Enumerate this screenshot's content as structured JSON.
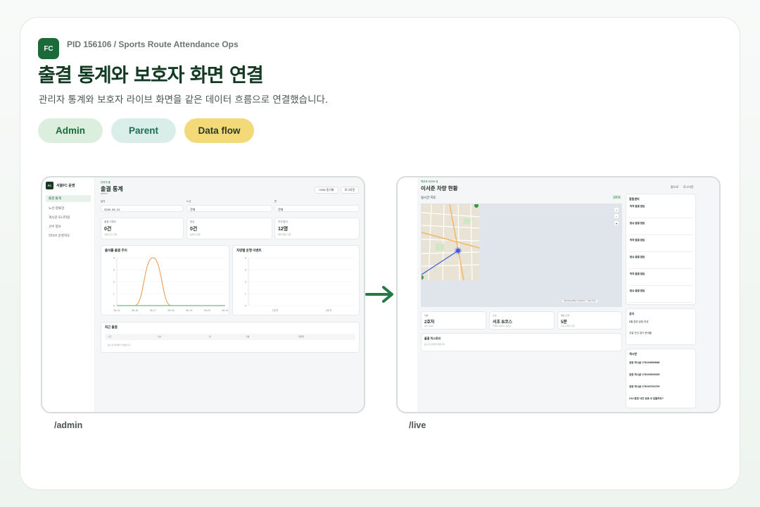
{
  "header": {
    "logo_text": "FC",
    "pid_line": "PID 156106 / Sports Route Attendance Ops",
    "title": "출결 통계와 보호자 화면 연결",
    "subtitle": "관리자 통계와 보호자 라이브 화면을 같은 데이터 흐름으로 연결했습니다.",
    "pills": [
      "Admin",
      "Parent",
      "Data flow"
    ]
  },
  "admin": {
    "route_label": "/admin",
    "brand_logo": "FC",
    "brand_name": "서울FC 운영",
    "nav": [
      "출결 통계",
      "노선·정류장",
      "게시글 모니터링",
      "선수 정보",
      "라이브 운영지도"
    ],
    "eyebrow": "관리자 홈",
    "page_title": "출결 통계",
    "page_sub": "admin",
    "btn_crm": "CRM 동기화",
    "btn_logout": "로그아웃",
    "filters": [
      {
        "label": "일자",
        "value": "2026. 06. 21."
      },
      {
        "label": "노선",
        "value": "전체"
      },
      {
        "label": "반",
        "value": "전체"
      }
    ],
    "stats": [
      {
        "label": "출결 이벤트",
        "value": "0건",
        "note": "선택 조건 기준"
      },
      {
        "label": "탑승",
        "value": "0건",
        "note": "승하차 포함"
      },
      {
        "label": "지각/결석",
        "value": "12명",
        "note": "제외 항목 기준"
      }
    ],
    "chart_title": "출석률·출결 추이",
    "bar_title": "차량별 운행 이벤트",
    "recent_title": "최근 출결",
    "table_cols": [
      "시간",
      "선수",
      "반",
      "구분",
      "정류장"
    ],
    "table_empty": "표시할 데이터가 없습니다."
  },
  "live": {
    "route_label": "/live",
    "eyebrow": "학부모 라이브 뷰",
    "page_title": "이서준 차량 현황",
    "top_links": [
      "홈으로",
      "로그아웃"
    ],
    "map_label": "실시간 지도",
    "live_badge": "운행 중",
    "attribution": "OpenStreetMap contributors · https://osm",
    "cards": [
      {
        "label": "차량",
        "value": "2호차",
        "note": "46가 1234"
      },
      {
        "label": "노선",
        "value": "서초 B코스",
        "note": "주말반 서울FC 정류장"
      },
      {
        "label": "예상 도착",
        "value": "5분",
        "note": "실시간 위치 기준"
      }
    ],
    "history_title": "출결 히스토리",
    "history_empty": "표시할 내역이 없습니다.",
    "alert_title": "알림센터",
    "alerts": [
      "하차 출결 알림",
      "탑승 출결 알림",
      "하차 출결 알림",
      "탑승 출결 알림",
      "하차 출결 알림",
      "탑승 출결 알림"
    ],
    "notice_title": "공지",
    "notices": [
      "6월 훈련 일정 안내",
      "주말 친선 경기 준비물"
    ],
    "board_title": "게시판",
    "posts": [
      "검증 게시글 1781949590688",
      "검증 게시글 1781949092545",
      "검증 게시글 1781947524709",
      "U10 훈련 사진 공유 수 있을까요?"
    ]
  },
  "chart_data": [
    {
      "type": "line",
      "title": "출석률·출결 추이",
      "categories": [
        "06-15",
        "06-16",
        "06-17",
        "06-18",
        "06-19",
        "06-20",
        "06-21"
      ],
      "ylim": [
        0,
        4
      ],
      "series": [
        {
          "values": [
            0,
            0,
            4,
            0,
            0,
            0,
            0
          ]
        },
        {
          "values": [
            0,
            0,
            0,
            0,
            0,
            0,
            0
          ]
        }
      ]
    },
    {
      "type": "bar",
      "title": "차량별 운행 이벤트",
      "categories": [
        "1호차",
        "2호차"
      ],
      "values": [
        0,
        0
      ],
      "ylim": [
        0,
        4
      ]
    }
  ],
  "colors": {
    "brand": "#1b6a3a",
    "orange": "#e8954a",
    "green": "#5aa36b"
  }
}
